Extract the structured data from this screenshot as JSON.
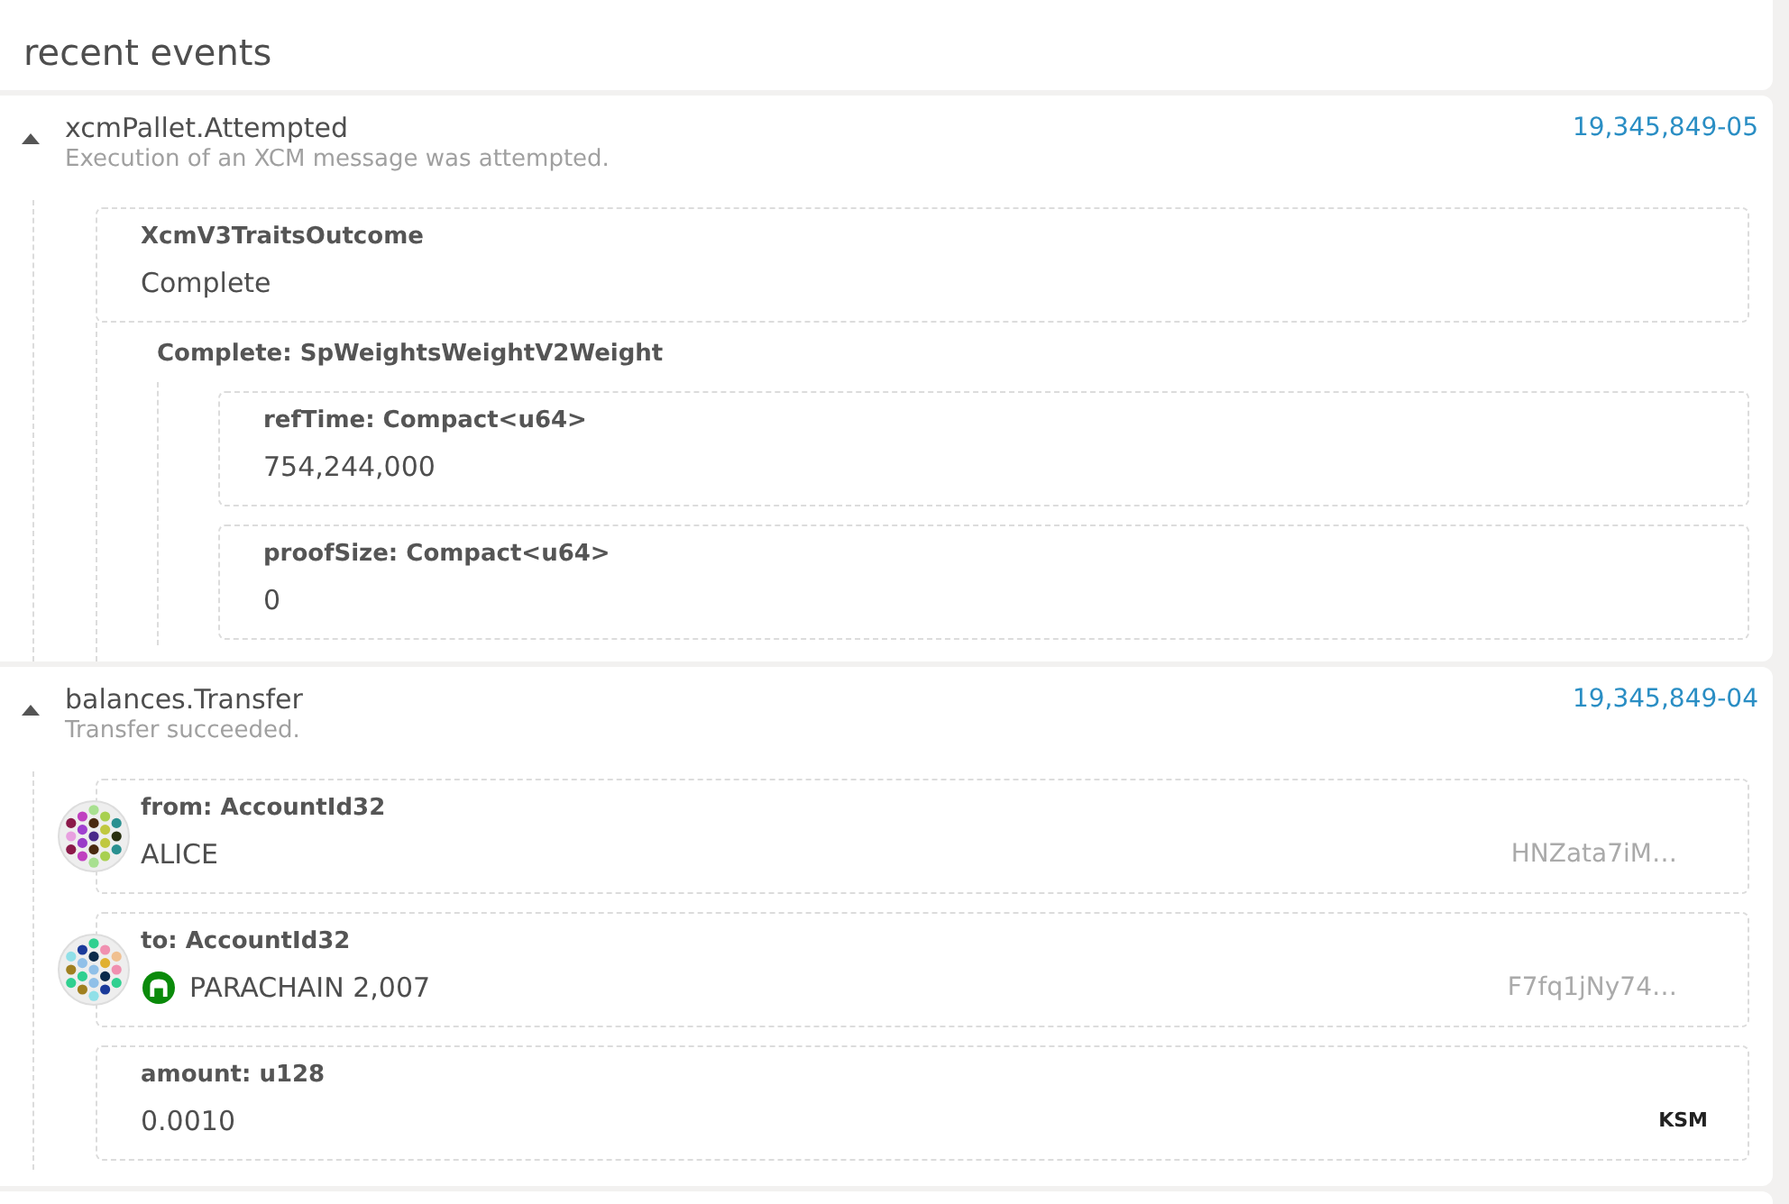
{
  "header": {
    "title": "recent events"
  },
  "events": [
    {
      "name": "xcmPallet.Attempted",
      "description": "Execution of an XCM message was attempted.",
      "block": "19,345,849-05",
      "expanded": true,
      "params": [
        {
          "kind": "value",
          "label": "XcmV3TraitsOutcome",
          "value": "Complete"
        },
        {
          "kind": "struct",
          "label": "Complete: SpWeightsWeightV2Weight",
          "children": [
            {
              "kind": "value",
              "label": "refTime: Compact<u64>",
              "value": "754,244,000"
            },
            {
              "kind": "value",
              "label": "proofSize: Compact<u64>",
              "value": "0"
            }
          ]
        }
      ]
    },
    {
      "name": "balances.Transfer",
      "description": "Transfer succeeded.",
      "block": "19,345,849-04",
      "expanded": true,
      "params": [
        {
          "kind": "account",
          "label": "from: AccountId32",
          "value": "ALICE",
          "address": "HNZata7iM…",
          "parachain": false
        },
        {
          "kind": "account",
          "label": "to: AccountId32",
          "value": "PARACHAIN 2,007",
          "address": "F7fq1jNy74…",
          "parachain": true
        },
        {
          "kind": "balance",
          "label": "amount: u128",
          "value": "0.0010",
          "unit": "KSM"
        }
      ]
    }
  ]
}
